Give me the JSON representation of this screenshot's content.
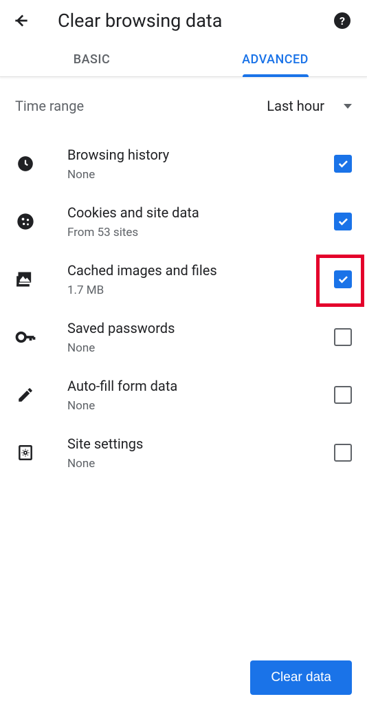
{
  "header": {
    "title": "Clear browsing data"
  },
  "tabs": {
    "basic": "BASIC",
    "advanced": "ADVANCED",
    "active": "advanced"
  },
  "time_range": {
    "label": "Time range",
    "value": "Last hour"
  },
  "items": [
    {
      "id": "browsing-history",
      "icon": "clock-icon",
      "title": "Browsing history",
      "sub": "None",
      "checked": true,
      "highlighted": false
    },
    {
      "id": "cookies",
      "icon": "cookie-icon",
      "title": "Cookies and site data",
      "sub": "From 53 sites",
      "checked": true,
      "highlighted": false
    },
    {
      "id": "cached",
      "icon": "image-icon",
      "title": "Cached images and files",
      "sub": "1.7 MB",
      "checked": true,
      "highlighted": true
    },
    {
      "id": "passwords",
      "icon": "key-icon",
      "title": "Saved passwords",
      "sub": "None",
      "checked": false,
      "highlighted": false
    },
    {
      "id": "autofill",
      "icon": "pencil-icon",
      "title": "Auto-fill form data",
      "sub": "None",
      "checked": false,
      "highlighted": false
    },
    {
      "id": "site-settings",
      "icon": "settings-page-icon",
      "title": "Site settings",
      "sub": "None",
      "checked": false,
      "highlighted": false
    }
  ],
  "footer": {
    "clear_button": "Clear data"
  }
}
